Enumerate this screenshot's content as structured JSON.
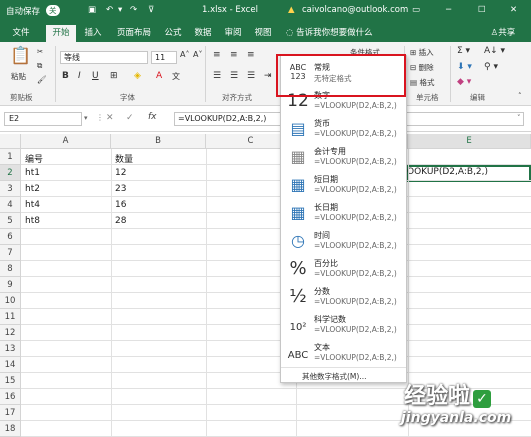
{
  "titlebar": {
    "autosave": "自动保存",
    "autosave_state": "关",
    "filename": "1.xlsx - Excel",
    "account": "caivolcano@outlook.com"
  },
  "tabs": [
    "文件",
    "开始",
    "插入",
    "页面布局",
    "公式",
    "数据",
    "审阅",
    "视图"
  ],
  "tellme": "告诉我你想要做什么",
  "share": "共享",
  "ribbon": {
    "paste": "粘贴",
    "clipboard": "剪贴板",
    "font_name": "等线",
    "font_size": "11",
    "font_group": "字体",
    "align_group": "对齐方式",
    "cond_format": "条件格式",
    "insert": "插入",
    "delete": "删除",
    "format": "格式",
    "cells_group": "单元格",
    "edit_group": "编辑"
  },
  "formula_bar": {
    "cell_ref": "E2",
    "cancel": "✕",
    "confirm": "✓",
    "fx": "fx",
    "formula": "=VLOOKUP(D2,A:B,2,)"
  },
  "grid": {
    "columns": [
      "A",
      "B",
      "C",
      "E"
    ],
    "rows": [
      "1",
      "2",
      "3",
      "4",
      "5",
      "6",
      "7",
      "8",
      "9",
      "10",
      "11",
      "12",
      "13",
      "14",
      "15",
      "16",
      "17",
      "18"
    ],
    "header_a": "编号",
    "header_b": "数量",
    "data": [
      {
        "a": "ht1",
        "b": "12"
      },
      {
        "a": "ht2",
        "b": "23"
      },
      {
        "a": "ht4",
        "b": "16"
      },
      {
        "a": "ht8",
        "b": "28"
      }
    ],
    "e2_text": "OOKUP(D2,A:B,2,)"
  },
  "format_menu": {
    "items": [
      {
        "icon": "ABC123",
        "label": "常规",
        "sub": "无特定格式"
      },
      {
        "icon": "12",
        "label": "数字",
        "sub": "=VLOOKUP(D2,A:B,2,)"
      },
      {
        "icon": "money",
        "label": "货币",
        "sub": "=VLOOKUP(D2,A:B,2,)"
      },
      {
        "icon": "calc",
        "label": "会计专用",
        "sub": "=VLOOKUP(D2,A:B,2,)"
      },
      {
        "icon": "cal",
        "label": "短日期",
        "sub": "=VLOOKUP(D2,A:B,2,)"
      },
      {
        "icon": "cal",
        "label": "长日期",
        "sub": "=VLOOKUP(D2,A:B,2,)"
      },
      {
        "icon": "clock",
        "label": "时间",
        "sub": "=VLOOKUP(D2,A:B,2,)"
      },
      {
        "icon": "%",
        "label": "百分比",
        "sub": "=VLOOKUP(D2,A:B,2,)"
      },
      {
        "icon": "½",
        "label": "分数",
        "sub": "=VLOOKUP(D2,A:B,2,)"
      },
      {
        "icon": "10²",
        "label": "科学记数",
        "sub": "=VLOOKUP(D2,A:B,2,)"
      },
      {
        "icon": "ABC",
        "label": "文本",
        "sub": "=VLOOKUP(D2,A:B,2,)"
      }
    ],
    "more": "其他数字格式(M)..."
  },
  "watermark": {
    "line1": "经验啦",
    "line2": "jingyanla.com",
    "check": "✓"
  },
  "colors": {
    "excel_green": "#217346",
    "highlight_red": "#d9141f"
  }
}
